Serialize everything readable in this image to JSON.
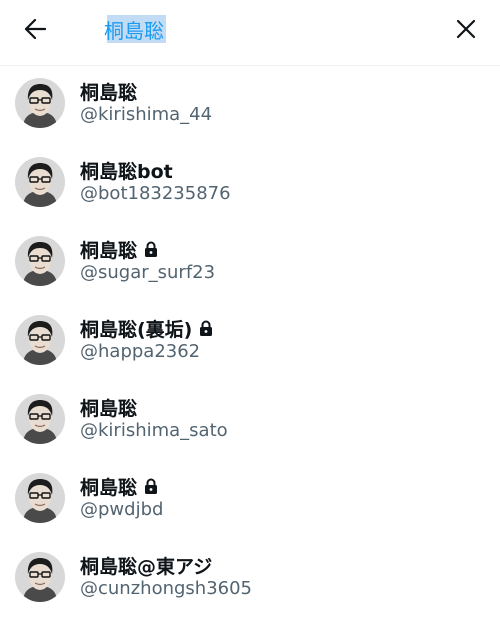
{
  "search": {
    "query": "桐島聡",
    "back_icon": "arrow-left-icon",
    "close_icon": "close-icon"
  },
  "colors": {
    "accent": "#1d9bf0",
    "selection": "#c3dcf5",
    "text_primary": "#0f1419",
    "text_secondary": "#536471",
    "divider": "#eff3f4"
  },
  "results": [
    {
      "name": "桐島聡",
      "handle": "@kirishima_44",
      "protected": false
    },
    {
      "name": "桐島聡bot",
      "handle": "@bot183235876",
      "protected": false
    },
    {
      "name": "桐島聡",
      "handle": "@sugar_surf23",
      "protected": true
    },
    {
      "name": "桐島聡(裏垢)",
      "handle": "@happa2362",
      "protected": true
    },
    {
      "name": "桐島聡",
      "handle": "@kirishima_sato",
      "protected": false
    },
    {
      "name": "桐島聡",
      "handle": "@pwdjbd",
      "protected": true
    },
    {
      "name": "桐島聡@東アジ",
      "handle": "@cunzhongsh3605",
      "protected": false
    }
  ]
}
